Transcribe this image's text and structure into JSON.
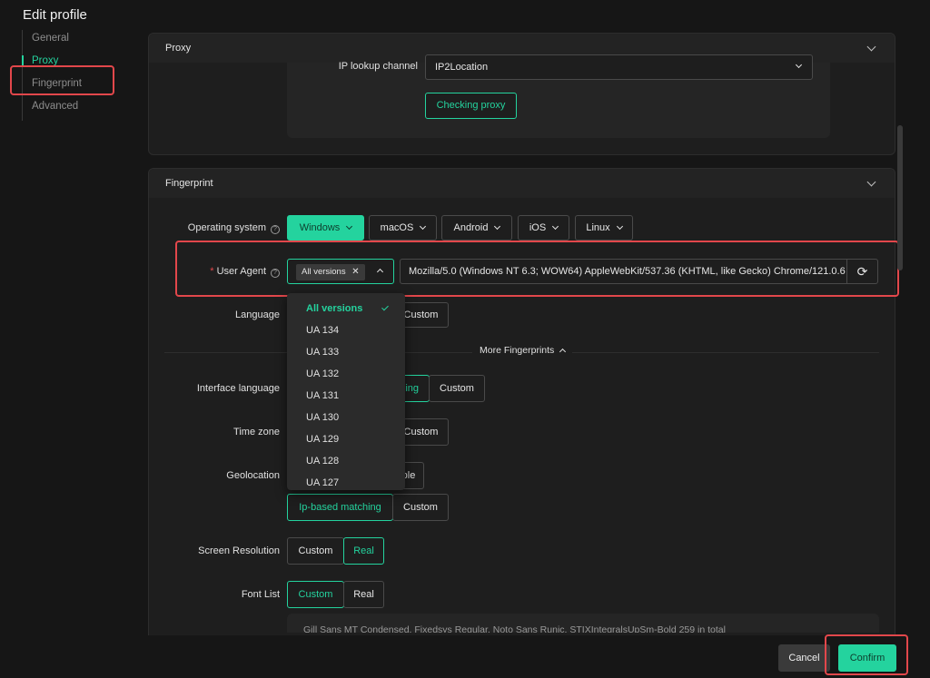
{
  "title": "Edit profile",
  "nav": [
    {
      "label": "General",
      "active": false
    },
    {
      "label": "Proxy",
      "active": true
    },
    {
      "label": "Fingerprint",
      "active": false
    },
    {
      "label": "Advanced",
      "active": false
    }
  ],
  "proxy": {
    "header": "Proxy",
    "ip_lookup_label": "IP lookup channel",
    "ip_lookup_value": "IP2Location",
    "check_button": "Checking proxy"
  },
  "fingerprint": {
    "header": "Fingerprint",
    "os_label": "Operating system",
    "os_options": [
      "Windows",
      "macOS",
      "Android",
      "iOS",
      "Linux"
    ],
    "ua_required_mark": "*",
    "ua_label": "User Agent",
    "ua_tag": "All versions",
    "ua_value": "Mozilla/5.0 (Windows NT 6.3; WOW64) AppleWebKit/537.36 (KHTML, like Gecko) Chrome/121.0.6",
    "language_label": "Language",
    "language_custom": "Custom",
    "more_fingerprints": "More Fingerprints",
    "interface_language_label": "Interface language",
    "interface_language_partial": "ing",
    "interface_language_custom": "Custom",
    "time_zone_label": "Time zone",
    "time_zone_custom": "Custom",
    "geolocation_label": "Geolocation",
    "geolocation_partial": "ple",
    "geolocation_match": "Ip-based matching",
    "geolocation_custom": "Custom",
    "screen_label": "Screen Resolution",
    "screen_custom": "Custom",
    "screen_real": "Real",
    "font_label": "Font List",
    "font_custom": "Custom",
    "font_real": "Real",
    "font_list_text": "Gill Sans MT Condensed, Fixedsys Regular, Noto Sans Runic, STIXIntegralsUpSm-Bold 259 in total"
  },
  "ua_menu": [
    "All versions",
    "UA 134",
    "UA 133",
    "UA 132",
    "UA 131",
    "UA 130",
    "UA 129",
    "UA 128",
    "UA 127"
  ],
  "footer": {
    "cancel": "Cancel",
    "confirm": "Confirm"
  },
  "colors": {
    "accent": "#24d39e",
    "highlight": "#e2474b",
    "background": "#161616"
  }
}
